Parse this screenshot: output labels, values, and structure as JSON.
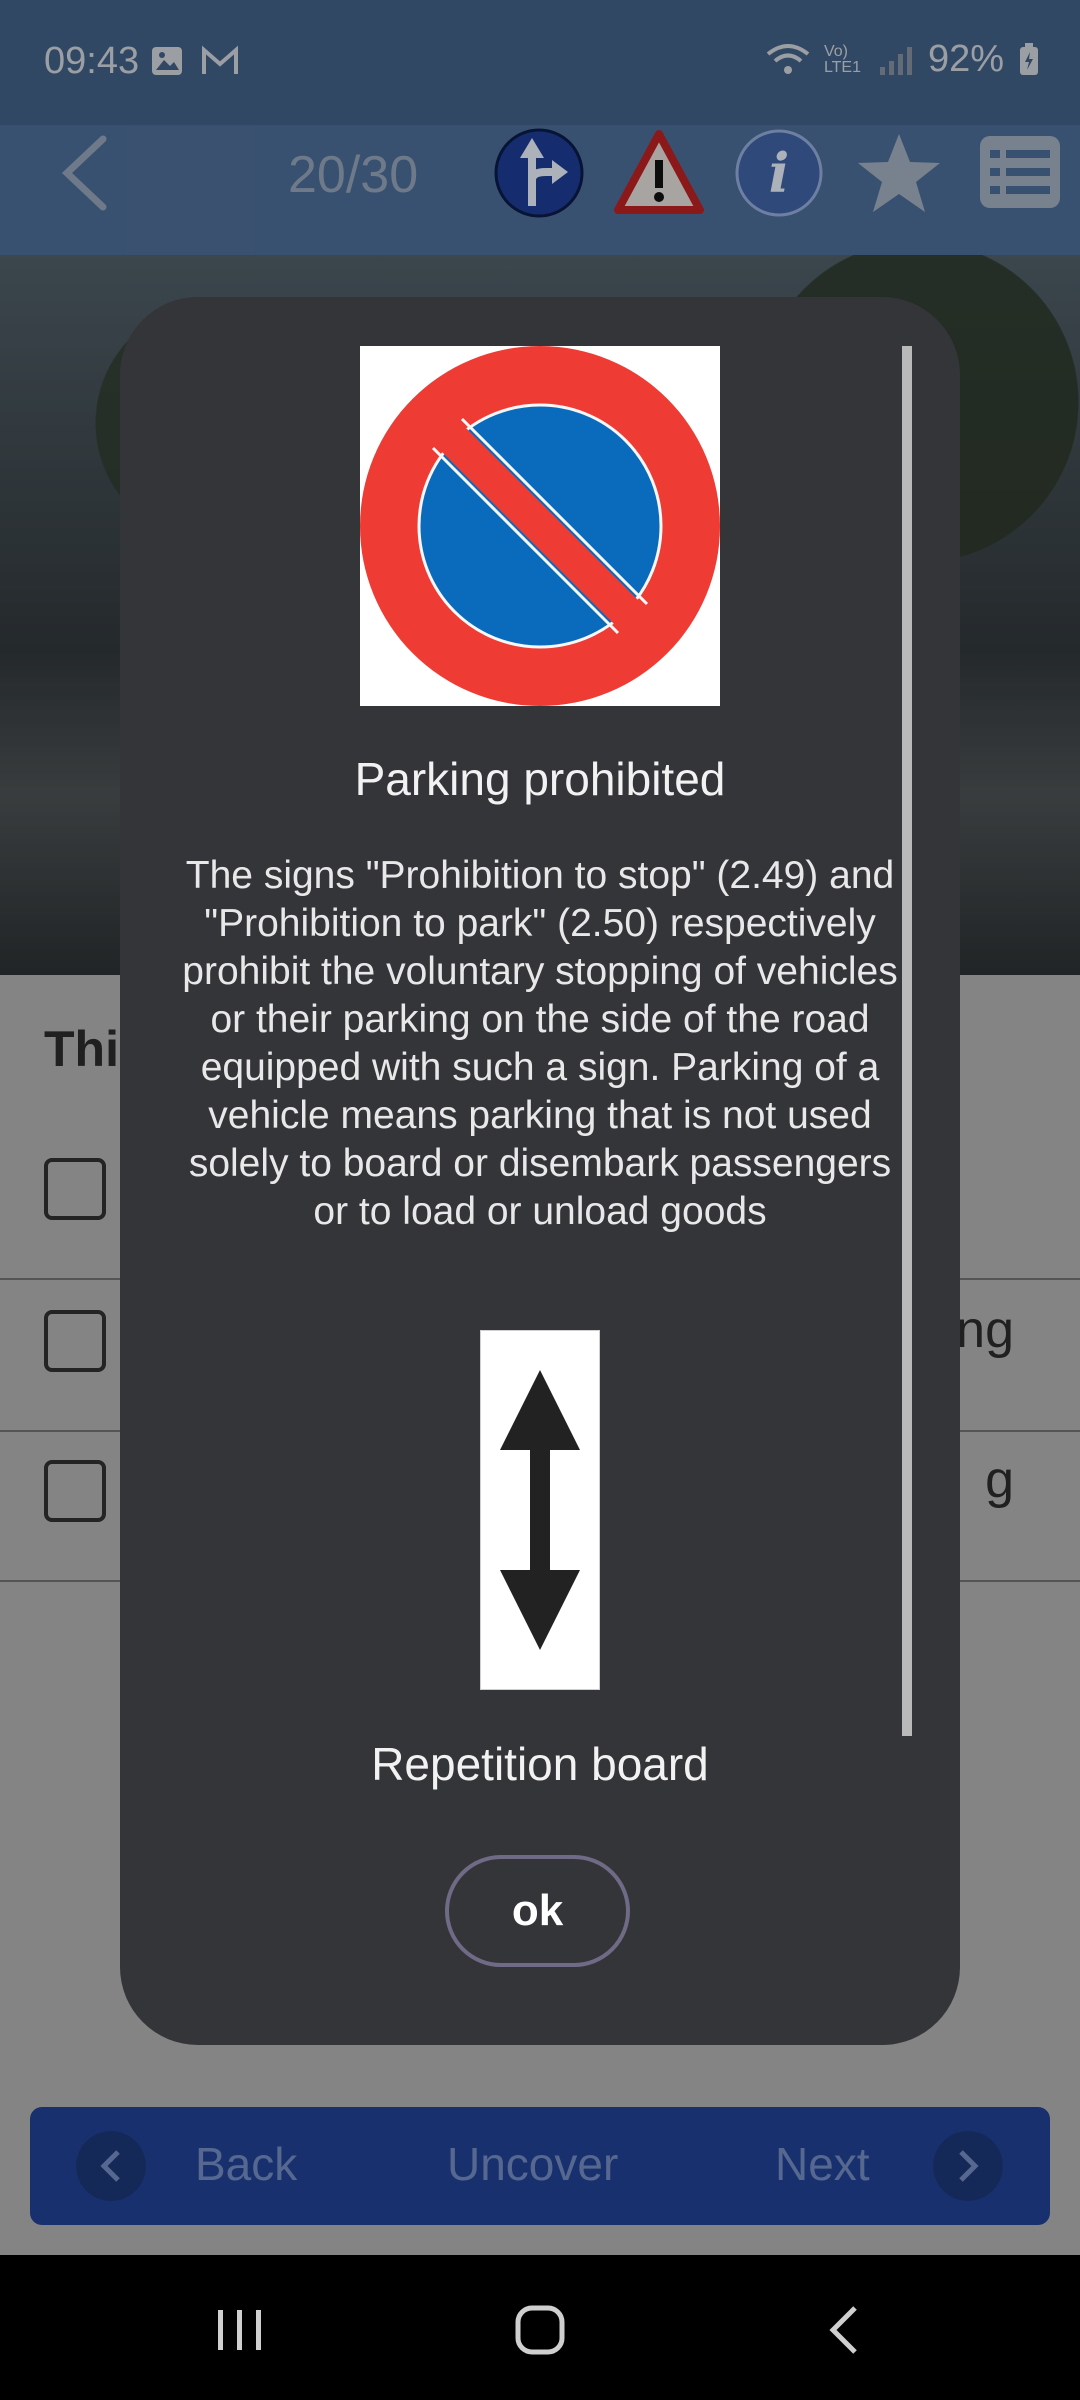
{
  "status_bar": {
    "time": "09:43",
    "battery": "92%",
    "network_label": "Vo) LTE1"
  },
  "toolbar": {
    "counter": "20/30",
    "icons": [
      "back-chevron-icon",
      "direction-sign-icon",
      "warning-triangle-icon",
      "info-icon",
      "star-icon",
      "list-icon"
    ]
  },
  "question": {
    "title_partial": "Thi",
    "answers": [
      {
        "partial_text": ""
      },
      {
        "partial_text": "ng"
      },
      {
        "partial_text": "g"
      }
    ]
  },
  "dialog": {
    "sign1_name": "Parking prohibited",
    "sign1_description": "The signs \"Prohibition to stop\" (2.49) and \"Prohibition to park\" (2.50) respectively prohibit the voluntary stopping of vehicles or their parking on the side of the road equipped with such a sign. Parking of a vehicle means parking that is not used solely to board or disembark passengers or to load or unload goods",
    "sign2_name": "Repetition board",
    "ok_label": "ok"
  },
  "action_bar": {
    "back_label": "Back",
    "uncover_label": "Uncover",
    "next_label": "Next"
  },
  "colors": {
    "app_bar": "#4a6890",
    "dialog_bg": "#343538",
    "sign_red": "#ee3b34",
    "sign_blue": "#0a6bbd",
    "action_bar": "#1f3f8e"
  }
}
